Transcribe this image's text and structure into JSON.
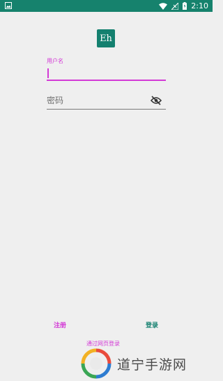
{
  "status_bar": {
    "time": "2:10"
  },
  "app": {
    "logo_text": "Eh"
  },
  "login_form": {
    "username_label": "用户名",
    "username_value": "",
    "password_placeholder": "密码",
    "password_value": ""
  },
  "actions": {
    "register_label": "注册",
    "login_label": "登录",
    "web_login_label": "通过网页登录"
  },
  "watermark": {
    "text": "道宁手游网"
  },
  "colors": {
    "primary": "#14806f",
    "accent": "#d33ad6",
    "background": "#efefef"
  }
}
